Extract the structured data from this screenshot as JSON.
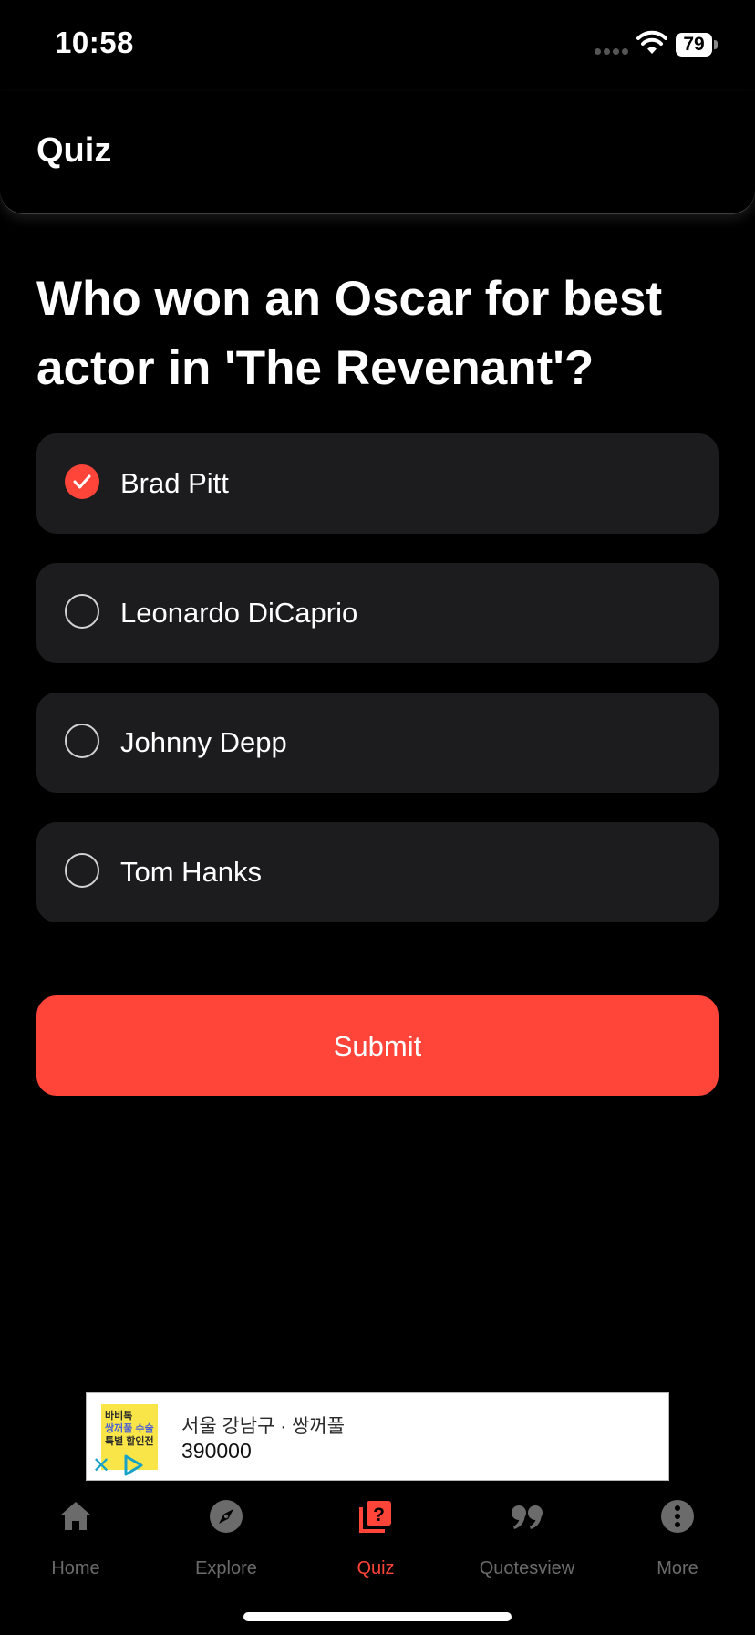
{
  "status_bar": {
    "time": "10:58",
    "battery": "79"
  },
  "header": {
    "title": "Quiz"
  },
  "quiz": {
    "question": "Who won an Oscar for best actor in 'The Revenant'?",
    "options": [
      {
        "label": "Brad Pitt",
        "selected": true
      },
      {
        "label": "Leonardo DiCaprio",
        "selected": false
      },
      {
        "label": "Johnny Depp",
        "selected": false
      },
      {
        "label": "Tom Hanks",
        "selected": false
      }
    ],
    "submit_label": "Submit"
  },
  "ad": {
    "thumb_lines": [
      "바비톡",
      "쌍꺼풀 수술",
      "특별 할인전"
    ],
    "line1": "서울 강남구 · 쌍꺼풀",
    "line2": "390000"
  },
  "tabs": [
    {
      "label": "Home",
      "icon": "home-icon",
      "active": false
    },
    {
      "label": "Explore",
      "icon": "compass-icon",
      "active": false
    },
    {
      "label": "Quiz",
      "icon": "quiz-icon",
      "active": true
    },
    {
      "label": "Quotesview",
      "icon": "quote-icon",
      "active": false
    },
    {
      "label": "More",
      "icon": "more-icon",
      "active": false
    }
  ],
  "colors": {
    "accent": "#ff453a",
    "card": "#1c1c1e",
    "background": "#000000",
    "inactive_tab": "#6b6b6b"
  }
}
